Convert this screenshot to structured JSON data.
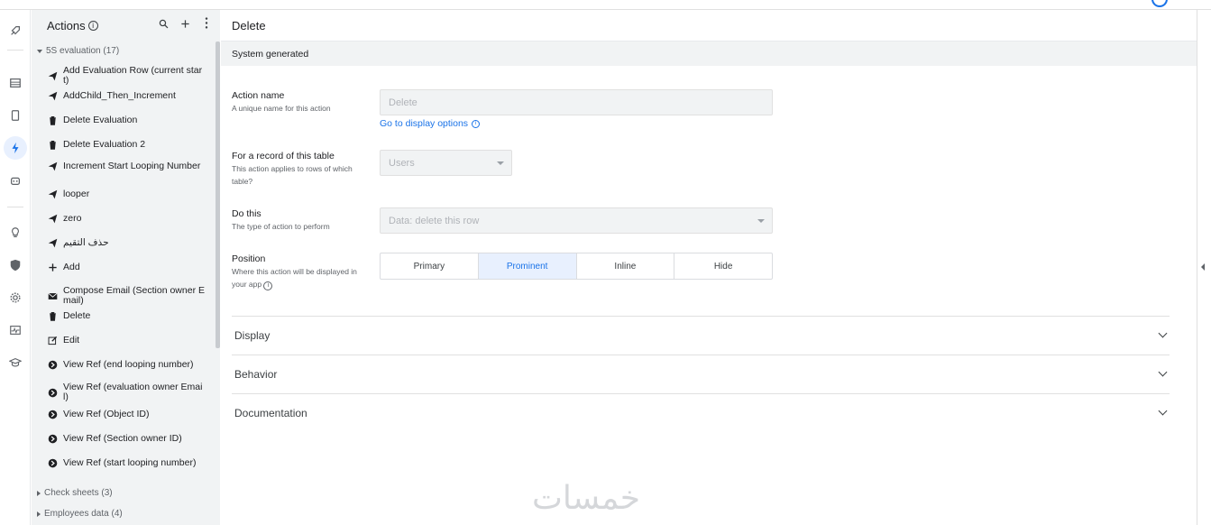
{
  "sidebar": {
    "title": "Actions",
    "info_glyph": "i",
    "groups": [
      {
        "label": "5S evaluation (17)",
        "expanded": true
      },
      {
        "label": "Check sheets (3)",
        "expanded": false
      },
      {
        "label": "Employees data (4)",
        "expanded": false
      }
    ],
    "items": [
      {
        "label": "Add Evaluation Row (current start)",
        "icon": "send-icon"
      },
      {
        "label": "AddChild_Then_Increment",
        "icon": "send-icon"
      },
      {
        "label": "Delete Evaluation",
        "icon": "trash-icon"
      },
      {
        "label": "Delete Evaluation 2",
        "icon": "trash-icon"
      },
      {
        "label": "Increment Start Looping Number",
        "icon": "send-icon"
      },
      {
        "label": "looper",
        "icon": "send-icon"
      },
      {
        "label": "zero",
        "icon": "send-icon"
      },
      {
        "label": "حذف التقيم",
        "icon": "send-icon"
      },
      {
        "label": "Add",
        "icon": "plus-icon"
      },
      {
        "label": "Compose Email (Section owner Email)",
        "icon": "mail-icon"
      },
      {
        "label": "Delete",
        "icon": "trash-icon"
      },
      {
        "label": "Edit",
        "icon": "edit-icon"
      },
      {
        "label": "View Ref (end looping number)",
        "icon": "arrow-circle-icon"
      },
      {
        "label": "View Ref (evaluation owner Email)",
        "icon": "arrow-circle-icon"
      },
      {
        "label": "View Ref (Object ID)",
        "icon": "arrow-circle-icon"
      },
      {
        "label": "View Ref (Section owner ID)",
        "icon": "arrow-circle-icon"
      },
      {
        "label": "View Ref (start looping number)",
        "icon": "arrow-circle-icon"
      }
    ]
  },
  "main": {
    "title": "Delete",
    "system_generated": "System generated",
    "action_name": {
      "label": "Action name",
      "desc": "A unique name for this action",
      "value": "Delete"
    },
    "display_link": "Go to display options",
    "record_table": {
      "label": "For a record of this table",
      "desc": "This action applies to rows of which table?",
      "value": "Users"
    },
    "do_this": {
      "label": "Do this",
      "desc": "The type of action to perform",
      "value": "Data: delete this row"
    },
    "position": {
      "label": "Position",
      "desc": "Where this action will be displayed in your app",
      "options": [
        "Primary",
        "Prominent",
        "Inline",
        "Hide"
      ],
      "selected": "Prominent"
    },
    "sections": [
      "Display",
      "Behavior",
      "Documentation"
    ]
  },
  "watermark": "خمسات",
  "colors": {
    "accent": "#1a73e8",
    "selected_bg": "#e8f0fe",
    "sidebar_bg": "#f1f3f4"
  }
}
